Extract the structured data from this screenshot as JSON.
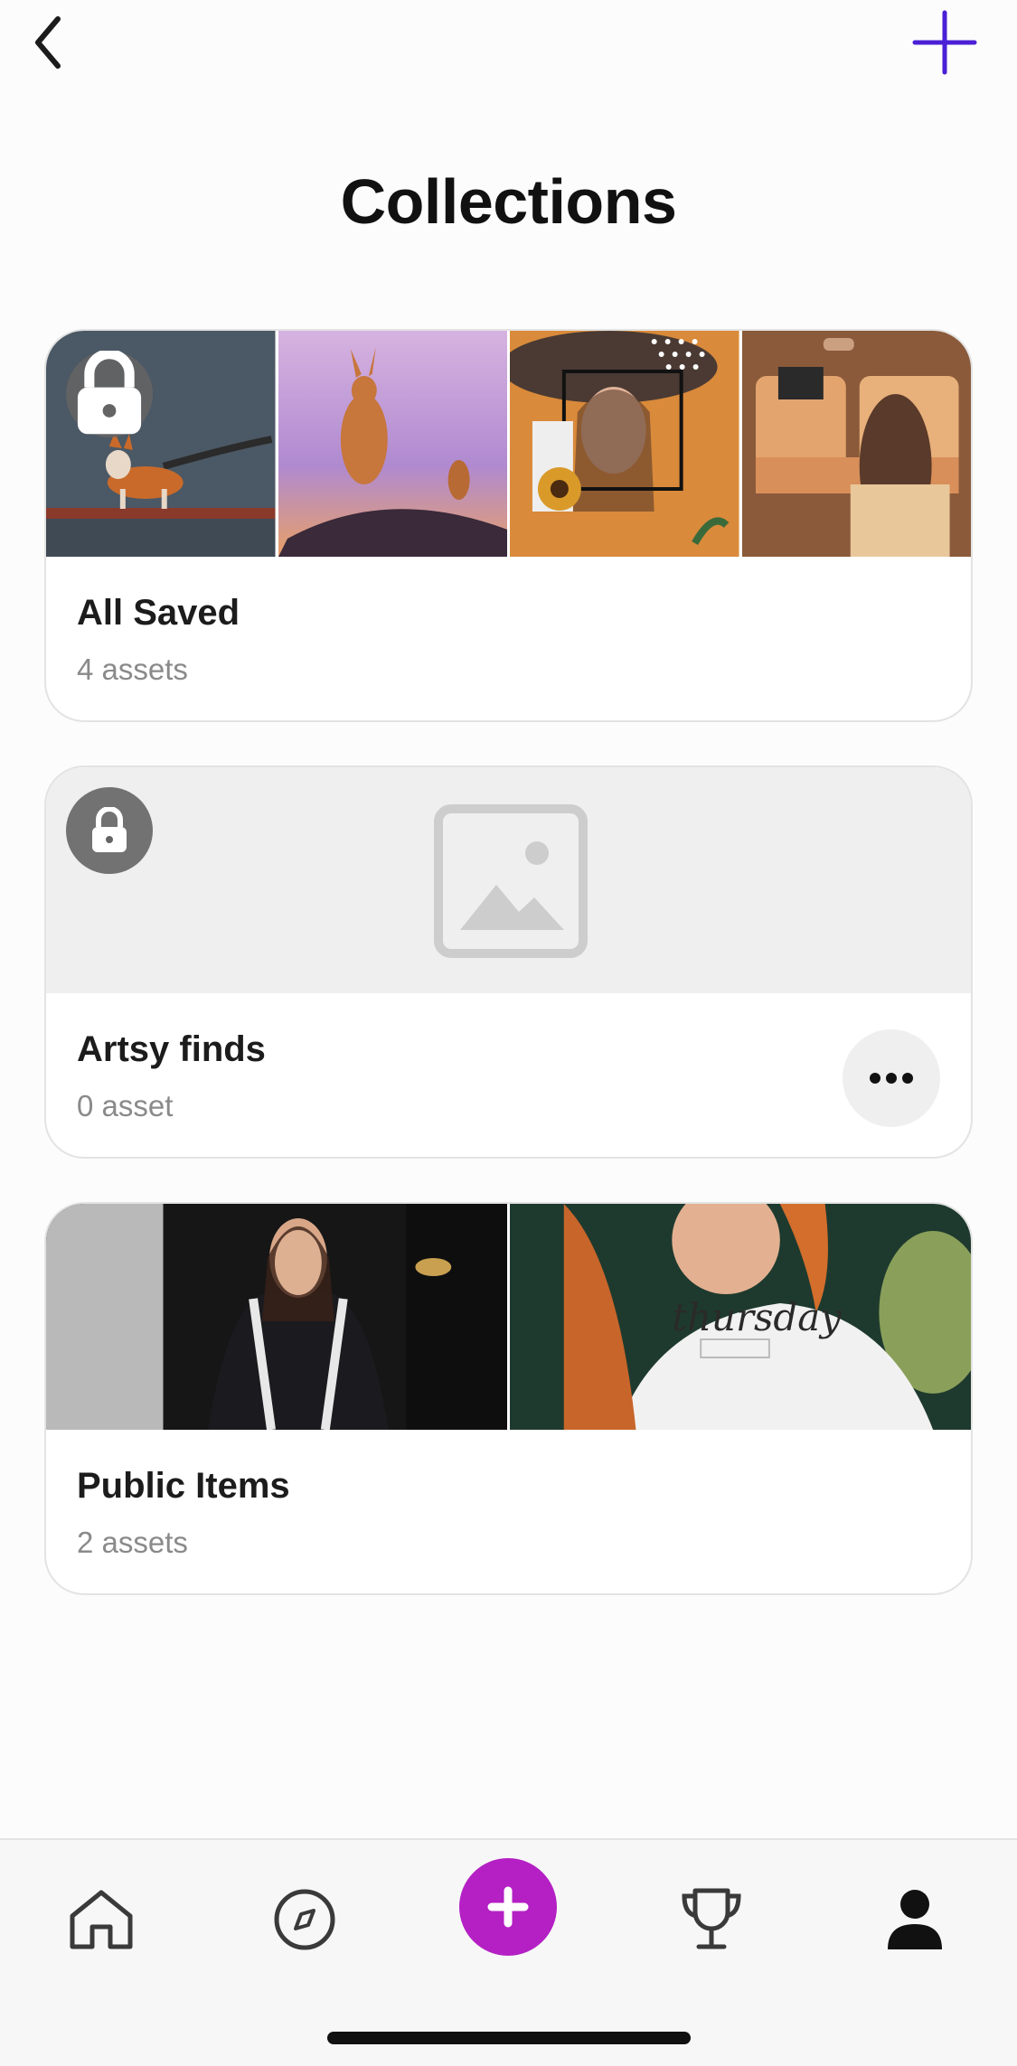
{
  "header": {
    "title": "Collections",
    "back_icon": "chevron-left-icon",
    "add_icon": "plus-icon",
    "accent_color": "#4a1fd6"
  },
  "collections": [
    {
      "name": "All Saved",
      "count": "4 assets",
      "locked": true,
      "thumbnails": [
        "fox-on-branch",
        "kangaroo-on-rock",
        "woman-with-hat-collage",
        "woman-in-train"
      ]
    },
    {
      "name": "Artsy finds",
      "count": "0 asset",
      "locked": true,
      "thumbnails": [],
      "placeholder_icon": "image-placeholder-icon",
      "more_icon": "more-horizontal-icon"
    },
    {
      "name": "Public Items",
      "count": "2 assets",
      "locked": false,
      "thumbnails": [
        "woman-in-jacket",
        "woman-red-hair"
      ],
      "overlay_text": "thursday"
    }
  ],
  "tab_bar": {
    "items": [
      "home-icon",
      "compass-icon",
      "create-plus-icon",
      "trophy-icon",
      "profile-icon"
    ],
    "create_color": "#b420c4"
  }
}
